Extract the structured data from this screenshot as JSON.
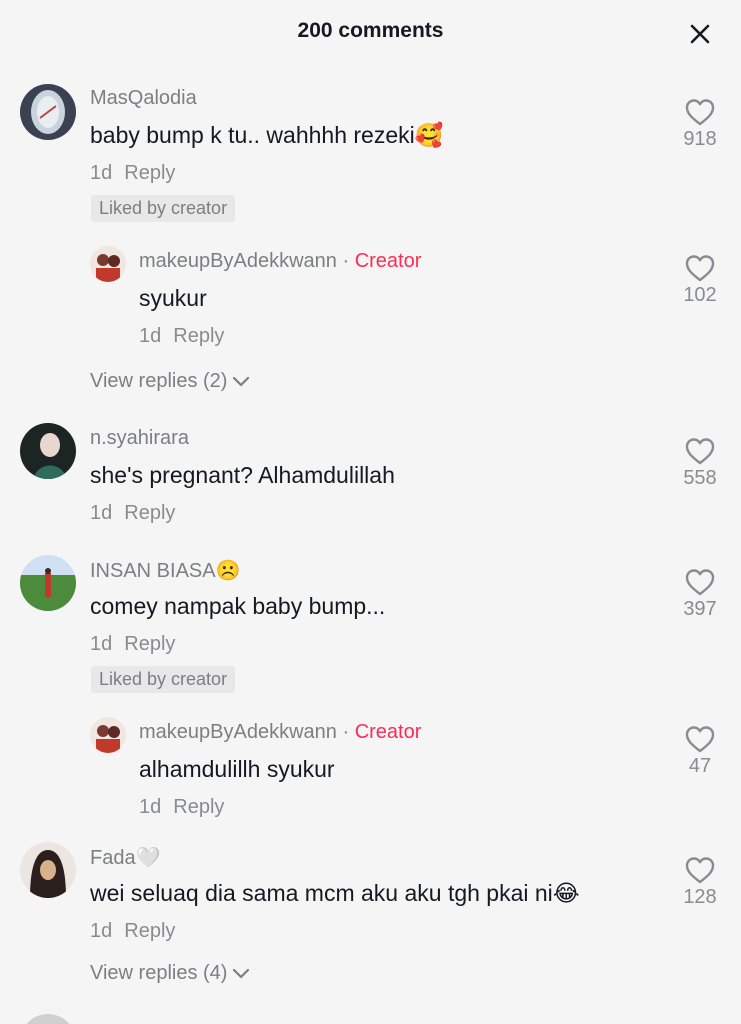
{
  "header": {
    "title": "200 comments",
    "close_icon": "close-icon"
  },
  "comments": [
    {
      "username": "MasQalodia",
      "text": "baby bump k tu.. wahhhh rezeki🥰",
      "time": "1d",
      "reply_label": "Reply",
      "liked_badge": "Liked by creator",
      "likes": "918",
      "avatar_colors": [
        "#6d7a8c",
        "#c9d3de"
      ],
      "reply": {
        "username": "makeupByAdekkwann",
        "separator": "·",
        "creator_label": "Creator",
        "text": "syukur",
        "time": "1d",
        "reply_label": "Reply",
        "likes": "102"
      },
      "view_replies": "View replies (2)"
    },
    {
      "username": "n.syahirara",
      "text": "she's pregnant? Alhamdulillah",
      "time": "1d",
      "reply_label": "Reply",
      "likes": "558",
      "avatar_colors": [
        "#1e2a2a",
        "#e8d7cf"
      ]
    },
    {
      "username": "INSAN BIASA☹️",
      "text": "comey nampak baby bump...",
      "time": "1d",
      "reply_label": "Reply",
      "liked_badge": "Liked by creator",
      "likes": "397",
      "avatar_colors": [
        "#4c8a3c",
        "#cfe0f2"
      ],
      "reply": {
        "username": "makeupByAdekkwann",
        "separator": "·",
        "creator_label": "Creator",
        "text": "alhamdulillh syukur",
        "time": "1d",
        "reply_label": "Reply",
        "likes": "47"
      }
    },
    {
      "username": "Fada🤍",
      "text": "wei seluaq dia sama mcm aku aku tgh pkai ni😂",
      "time": "1d",
      "reply_label": "Reply",
      "likes": "128",
      "avatar_colors": [
        "#2a1f1c",
        "#d9b08c"
      ],
      "view_replies": "View replies (4)"
    }
  ],
  "colors": {
    "creator": "#fe2c55",
    "muted": "#7d7e83",
    "text": "#161823"
  }
}
